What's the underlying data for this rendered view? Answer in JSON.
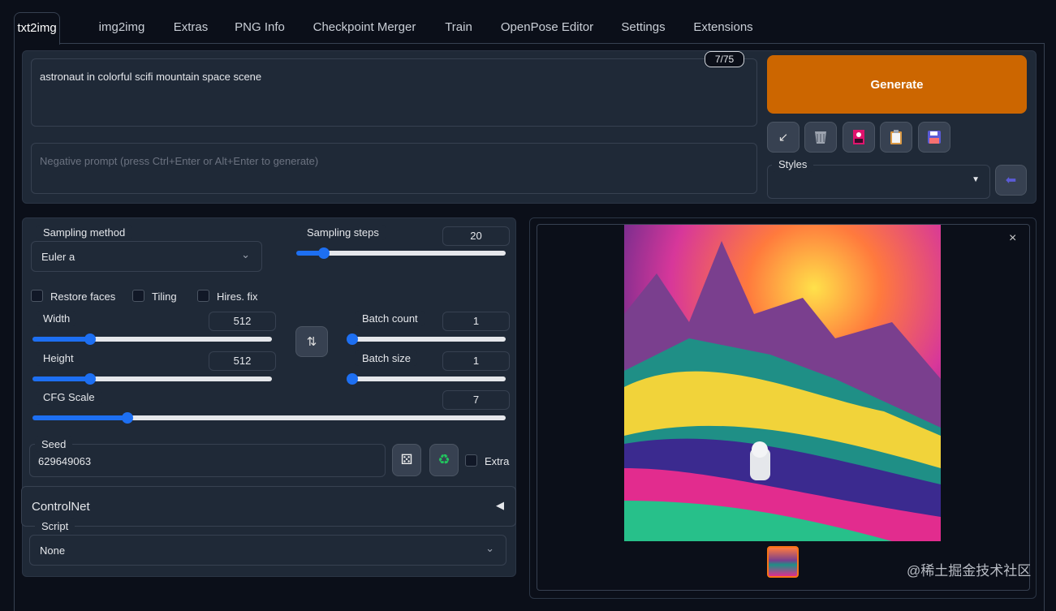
{
  "tabs": [
    "txt2img",
    "img2img",
    "Extras",
    "PNG Info",
    "Checkpoint Merger",
    "Train",
    "OpenPose Editor",
    "Settings",
    "Extensions"
  ],
  "prompt": {
    "value": "astronaut in colorful scifi mountain space scene",
    "token_count": "7/75",
    "negative_placeholder": "Negative prompt (press Ctrl+Enter or Alt+Enter to generate)"
  },
  "generate_label": "Generate",
  "styles": {
    "label": "Styles",
    "value": ""
  },
  "sampling": {
    "method_label": "Sampling method",
    "method_value": "Euler a",
    "steps_label": "Sampling steps",
    "steps_value": "20",
    "steps_fraction": 0.13
  },
  "checkboxes": [
    "Restore faces",
    "Tiling",
    "Hires. fix"
  ],
  "width": {
    "label": "Width",
    "value": "512",
    "fraction": 0.24
  },
  "height": {
    "label": "Height",
    "value": "512",
    "fraction": 0.24
  },
  "batch_count": {
    "label": "Batch count",
    "value": "1",
    "fraction": 0
  },
  "batch_size": {
    "label": "Batch size",
    "value": "1",
    "fraction": 0
  },
  "cfg": {
    "label": "CFG Scale",
    "value": "7",
    "fraction": 0.2
  },
  "seed": {
    "label": "Seed",
    "value": "629649063",
    "extra_label": "Extra"
  },
  "controlnet_label": "ControlNet",
  "script": {
    "label": "Script",
    "value": "None"
  },
  "watermark": "@稀土掘金技术社区",
  "colors": {
    "accent": "#1d6ff2",
    "generate": "#cc6600"
  }
}
